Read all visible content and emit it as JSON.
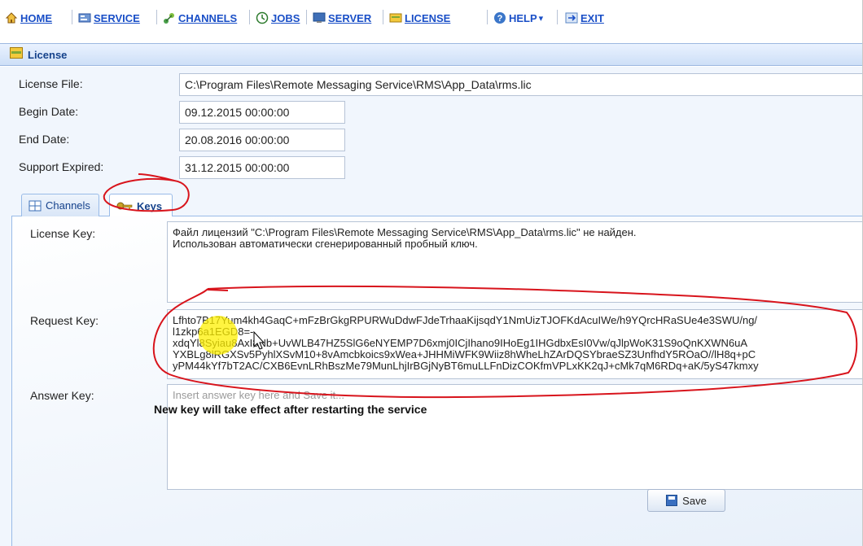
{
  "menu": {
    "items": [
      {
        "label": "HOME",
        "icon": "home-icon"
      },
      {
        "label": "SERVICE",
        "icon": "service-icon"
      },
      {
        "label": "CHANNELS",
        "icon": "channels-icon"
      },
      {
        "label": "JOBS",
        "icon": "jobs-icon"
      },
      {
        "label": "SERVER",
        "icon": "server-icon"
      },
      {
        "label": "LICENSE",
        "icon": "license-icon"
      },
      {
        "label": "HELP",
        "icon": "help-icon",
        "arrow": "▾"
      },
      {
        "label": "EXIT",
        "icon": "exit-icon"
      }
    ]
  },
  "panel": {
    "title": "License"
  },
  "fields": {
    "license_file": {
      "label": "License File:",
      "value": "C:\\Program Files\\Remote Messaging Service\\RMS\\App_Data\\rms.lic"
    },
    "begin_date": {
      "label": "Begin Date:",
      "value": "09.12.2015 00:00:00"
    },
    "end_date": {
      "label": "End Date:",
      "value": "20.08.2016 00:00:00"
    },
    "support_expired": {
      "label": "Support Expired:",
      "value": "31.12.2015 00:00:00"
    }
  },
  "tabs": {
    "channels": "Channels",
    "keys": "Keys"
  },
  "keys": {
    "license_key": {
      "label": "License Key:",
      "lines": [
        "Файл лицензий \"C:\\Program Files\\Remote Messaging Service\\RMS\\App_Data\\rms.lic\" не найден.",
        "Использован автоматически сгенерированный пробный ключ."
      ]
    },
    "request_key": {
      "label": "Request Key:",
      "lines": [
        "Lfhto7B17Yum4kh4GaqC+mFzBrGkgRPURWuDdwFJdeTrhaaKijsqdY1NmUizTJOFKdAcuIWe/h9YQrcHRaSUe4e3SWU/ng/",
        "l1zkp6a1EGD8=-",
        "xdqYl8Syiau8AxI8Nb+UvWLB47HZ5SlG6eNYEMP7D6xmj0ICjIhano9IHoEg1IHGdbxEsI0Vw/qJlpWoK31S9oQnKXWN6uA",
        "YXBLg8lRGXSv5PyhlXSvM10+8vAmcbkoics9xWea+JHHMiWFK9Wiiz8hWheLhZArDQSYbraeSZ3UnfhdY5ROaO//lH8q+pC",
        "yPM44kYf7bT2AC/CXB6EvnLRhBszMe79MunLhjIrBGjNyBT6muLLFnDizCOKfmVPLxKK2qJ+cMk7qM6RDq+aK/5yS47kmxy"
      ]
    },
    "answer_key": {
      "label": "Answer Key:",
      "placeholder": "Insert answer key here and Save it..."
    },
    "note": "New key will take effect after restarting the service",
    "save_label": "Save"
  },
  "colors": {
    "menu_link": "#1a4fc7",
    "panel_header": "#15428b",
    "annotation": "#d8141c",
    "highlight": "#ffe900"
  }
}
